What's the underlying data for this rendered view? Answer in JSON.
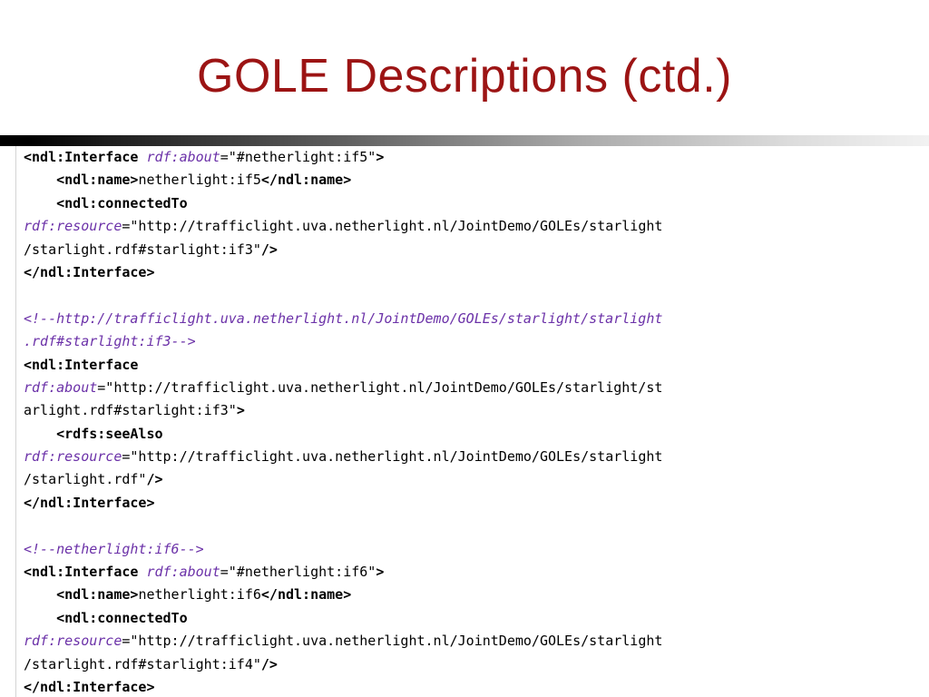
{
  "slide": {
    "title": "GOLE Descriptions (ctd.)"
  },
  "colors": {
    "title": "#9c1414",
    "tag": "#000000",
    "attribute": "#6b31a8",
    "comment": "#6b31a8",
    "value": "#000000"
  },
  "code": {
    "language": "xml",
    "lines": [
      [
        {
          "t": "tag",
          "s": "<ndl:Interface "
        },
        {
          "t": "attr",
          "s": "rdf:about"
        },
        {
          "t": "value",
          "s": "=\"#netherlight:if5\""
        },
        {
          "t": "tag",
          "s": ">"
        }
      ],
      [
        {
          "t": "text",
          "s": "    "
        },
        {
          "t": "tag",
          "s": "<ndl:name>"
        },
        {
          "t": "text",
          "s": "netherlight:if5"
        },
        {
          "t": "tag",
          "s": "</ndl:name>"
        }
      ],
      [
        {
          "t": "text",
          "s": "    "
        },
        {
          "t": "tag",
          "s": "<ndl:connectedTo"
        }
      ],
      [
        {
          "t": "attr",
          "s": "rdf:resource"
        },
        {
          "t": "value",
          "s": "=\"http://trafficlight.uva.netherlight.nl/JointDemo/GOLEs/starlight"
        }
      ],
      [
        {
          "t": "value",
          "s": "/starlight.rdf#starlight:if3\""
        },
        {
          "t": "tag",
          "s": "/>"
        }
      ],
      [
        {
          "t": "tag",
          "s": "</ndl:Interface>"
        }
      ],
      [],
      [
        {
          "t": "comment",
          "s": "<!--http://trafficlight.uva.netherlight.nl/JointDemo/GOLEs/starlight/starlight"
        }
      ],
      [
        {
          "t": "comment",
          "s": ".rdf#starlight:if3-->"
        }
      ],
      [
        {
          "t": "tag",
          "s": "<ndl:Interface"
        }
      ],
      [
        {
          "t": "attr",
          "s": "rdf:about"
        },
        {
          "t": "value",
          "s": "=\"http://trafficlight.uva.netherlight.nl/JointDemo/GOLEs/starlight/st"
        }
      ],
      [
        {
          "t": "value",
          "s": "arlight.rdf#starlight:if3\""
        },
        {
          "t": "tag",
          "s": ">"
        }
      ],
      [
        {
          "t": "text",
          "s": "    "
        },
        {
          "t": "tag",
          "s": "<rdfs:seeAlso"
        }
      ],
      [
        {
          "t": "attr",
          "s": "rdf:resource"
        },
        {
          "t": "value",
          "s": "=\"http://trafficlight.uva.netherlight.nl/JointDemo/GOLEs/starlight"
        }
      ],
      [
        {
          "t": "value",
          "s": "/starlight.rdf\""
        },
        {
          "t": "tag",
          "s": "/>"
        }
      ],
      [
        {
          "t": "tag",
          "s": "</ndl:Interface>"
        }
      ],
      [],
      [
        {
          "t": "comment",
          "s": "<!--netherlight:if6-->"
        }
      ],
      [
        {
          "t": "tag",
          "s": "<ndl:Interface "
        },
        {
          "t": "attr",
          "s": "rdf:about"
        },
        {
          "t": "value",
          "s": "=\"#netherlight:if6\""
        },
        {
          "t": "tag",
          "s": ">"
        }
      ],
      [
        {
          "t": "text",
          "s": "    "
        },
        {
          "t": "tag",
          "s": "<ndl:name>"
        },
        {
          "t": "text",
          "s": "netherlight:if6"
        },
        {
          "t": "tag",
          "s": "</ndl:name>"
        }
      ],
      [
        {
          "t": "text",
          "s": "    "
        },
        {
          "t": "tag",
          "s": "<ndl:connectedTo"
        }
      ],
      [
        {
          "t": "attr",
          "s": "rdf:resource"
        },
        {
          "t": "value",
          "s": "=\"http://trafficlight.uva.netherlight.nl/JointDemo/GOLEs/starlight"
        }
      ],
      [
        {
          "t": "value",
          "s": "/starlight.rdf#starlight:if4\""
        },
        {
          "t": "tag",
          "s": "/>"
        }
      ],
      [
        {
          "t": "tag",
          "s": "</ndl:Interface>"
        }
      ]
    ]
  }
}
